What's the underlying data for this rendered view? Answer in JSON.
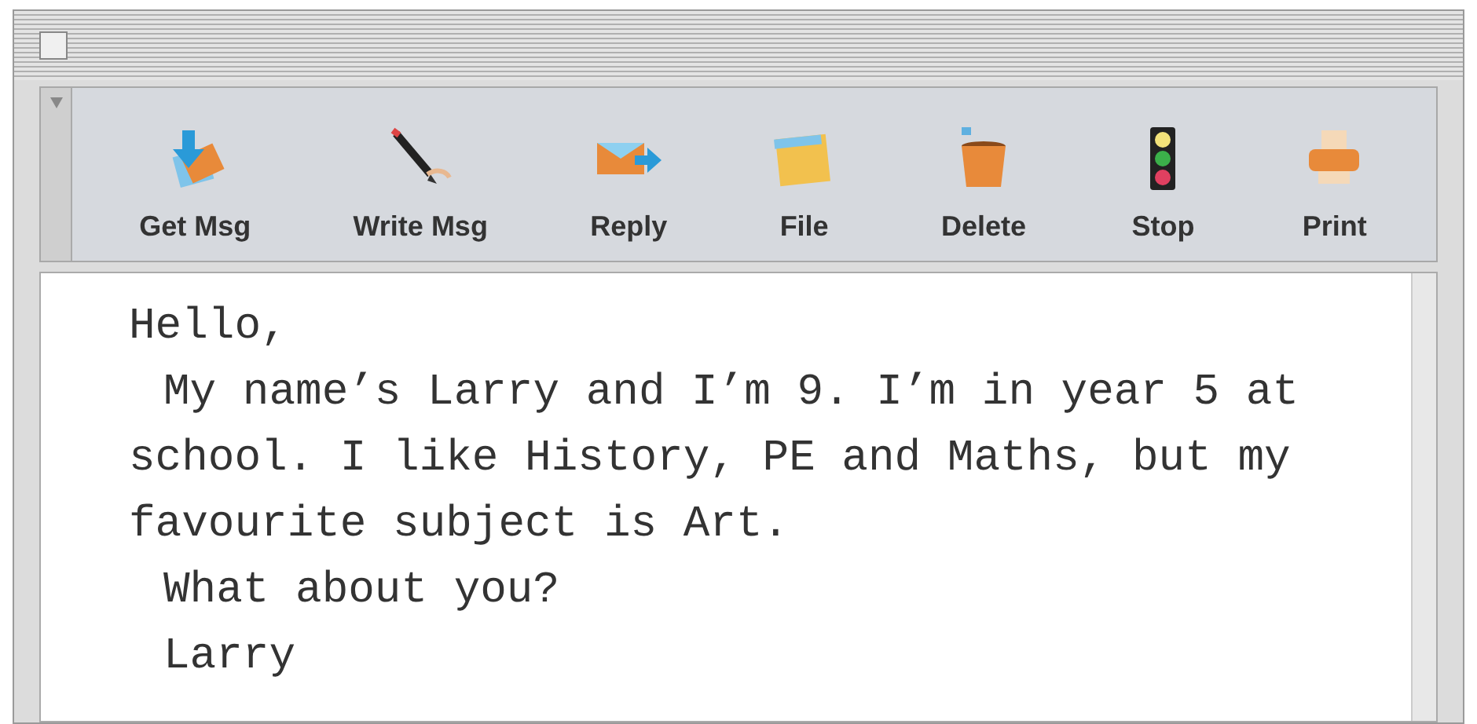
{
  "toolbar": [
    {
      "label": "Get Msg"
    },
    {
      "label": "Write Msg"
    },
    {
      "label": "Reply"
    },
    {
      "label": "File"
    },
    {
      "label": "Delete"
    },
    {
      "label": "Stop"
    },
    {
      "label": "Print"
    }
  ],
  "message": {
    "lines": [
      {
        "text": "Hello,",
        "indent": false
      },
      {
        "text": "My name’s Larry and I’m 9. I’m in year 5 at",
        "indent": true
      },
      {
        "text": "school. I like History, PE and Maths, but my",
        "indent": false
      },
      {
        "text": "favourite subject is Art.",
        "indent": false
      },
      {
        "text": "What about you?",
        "indent": true
      },
      {
        "text": "Larry",
        "indent": true
      }
    ]
  }
}
